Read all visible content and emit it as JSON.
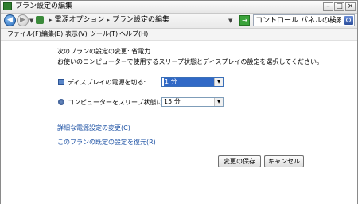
{
  "window": {
    "title": "プラン設定の編集",
    "minimize": "–",
    "maximize": "□",
    "close": "×"
  },
  "nav": {
    "back": "◀",
    "forward": "▶",
    "history": "▼",
    "refresh": "→",
    "breadcrumb": [
      "電源オプション",
      "プラン設定の編集"
    ],
    "crumb_separator": "▸",
    "dropdown": "▼"
  },
  "search": {
    "placeholder": "コントロール パネルの検索"
  },
  "menu": {
    "items": [
      "ファイル(F)",
      "編集(E)",
      "表示(V)",
      "ツール(T)",
      "ヘルプ(H)"
    ]
  },
  "main": {
    "heading": "次のプランの設定の変更: 省電力",
    "description": "お使いのコンピューターで使用するスリープ状態とディスプレイの設定を選択してください。",
    "display_off_label": "ディスプレイの電源を切る:",
    "display_off_value": "1 分",
    "sleep_label": "コンピューターをスリープ状態にする:",
    "sleep_value": "15 分",
    "advanced_link": "詳細な電源設定の変更(C)",
    "restore_link": "このプランの既定の設定を復元(R)",
    "save_button": "変更の保存",
    "cancel_button": "キャンセル"
  }
}
